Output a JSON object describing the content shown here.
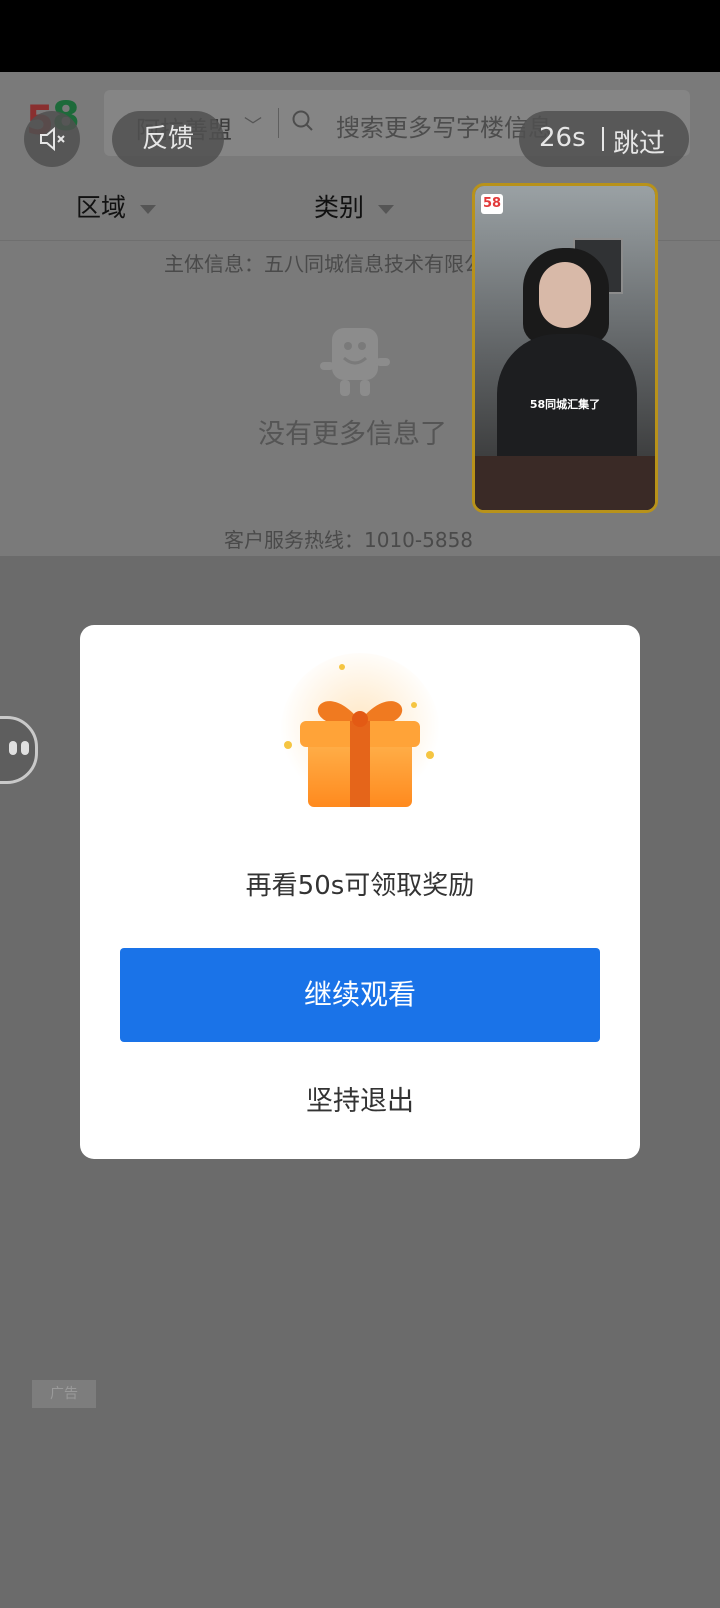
{
  "page": {
    "city": "阿拉善盟",
    "search_placeholder": "搜索更多写字楼信息",
    "filters": [
      {
        "label": "区域"
      },
      {
        "label": "类别"
      }
    ],
    "company_info": "主体信息：五八同城信息技术有限公司",
    "empty_text": "没有更多信息了",
    "hotline": "客户服务热线：1010-5858"
  },
  "ad": {
    "feedback_label": "反馈",
    "countdown": "26s",
    "skip_label": "跳过",
    "video_logo": "58",
    "video_caption": "58同城汇集了",
    "ad_tag": "广告"
  },
  "dialog": {
    "message": "再看50s可领取奖励",
    "continue_label": "继续观看",
    "exit_label": "坚持退出",
    "accent_color": "#1a73e8"
  }
}
